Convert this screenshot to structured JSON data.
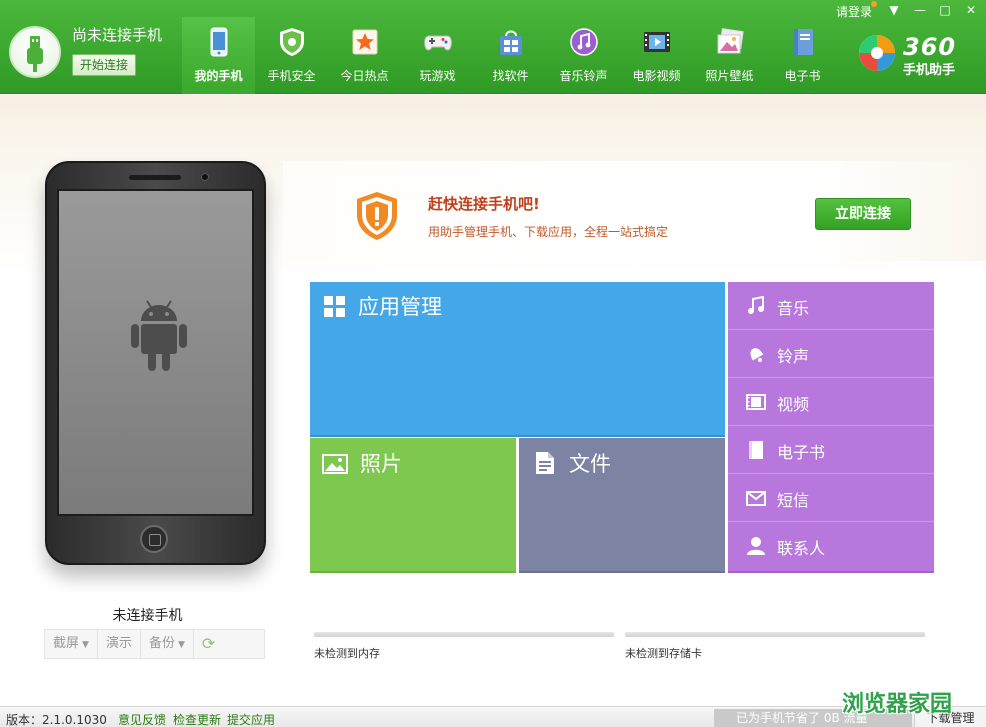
{
  "header": {
    "connection_title": "尚未连接手机",
    "connect_button": "开始连接",
    "login": "请登录",
    "window_controls": {
      "menu": "▼",
      "minimize": "—",
      "maximize": "□",
      "close": "✕"
    },
    "brand_number": "360",
    "brand_name": "手机助手",
    "nav": [
      {
        "label": "我的手机",
        "icon": "my-phone-icon",
        "active": true
      },
      {
        "label": "手机安全",
        "icon": "shield-icon"
      },
      {
        "label": "今日热点",
        "icon": "star-icon"
      },
      {
        "label": "玩游戏",
        "icon": "gamepad-icon"
      },
      {
        "label": "找软件",
        "icon": "app-bag-icon"
      },
      {
        "label": "音乐铃声",
        "icon": "music-icon"
      },
      {
        "label": "电影视频",
        "icon": "film-icon"
      },
      {
        "label": "照片壁纸",
        "icon": "picture-icon"
      },
      {
        "label": "电子书",
        "icon": "book-icon"
      }
    ]
  },
  "device": {
    "name": "未连接手机",
    "tools": {
      "screenshot": "截屏",
      "demo": "演示",
      "backup": "备份"
    }
  },
  "banner": {
    "title": "赶快连接手机吧!",
    "subtitle": "用助手管理手机、下载应用，全程一站式搞定",
    "button": "立即连接"
  },
  "tiles": {
    "apps": "应用管理",
    "photos": "照片",
    "files": "文件",
    "media": [
      {
        "label": "音乐",
        "icon": "music-note-icon"
      },
      {
        "label": "铃声",
        "icon": "bell-icon"
      },
      {
        "label": "视频",
        "icon": "film-strip-icon"
      },
      {
        "label": "电子书",
        "icon": "ebook-icon"
      },
      {
        "label": "短信",
        "icon": "envelope-icon"
      },
      {
        "label": "联系人",
        "icon": "contact-icon"
      }
    ]
  },
  "storage": {
    "memory": "未检测到内存",
    "sdcard": "未检测到存储卡"
  },
  "footer": {
    "version": "版本：2.1.0.1030",
    "feedback": "意见反馈",
    "check_update": "检查更新",
    "submit_app": "提交应用",
    "saved": "已为手机节省了 0B 流量",
    "download_manager": "下载管理"
  },
  "watermark": "浏览器家园",
  "colors": {
    "header_green": "#3aa82c",
    "tile_blue": "#44a7e8",
    "tile_green": "#7ec850",
    "tile_slate": "#7d84a3",
    "tile_purple": "#b777dc",
    "alert_orange": "#f08a24"
  }
}
